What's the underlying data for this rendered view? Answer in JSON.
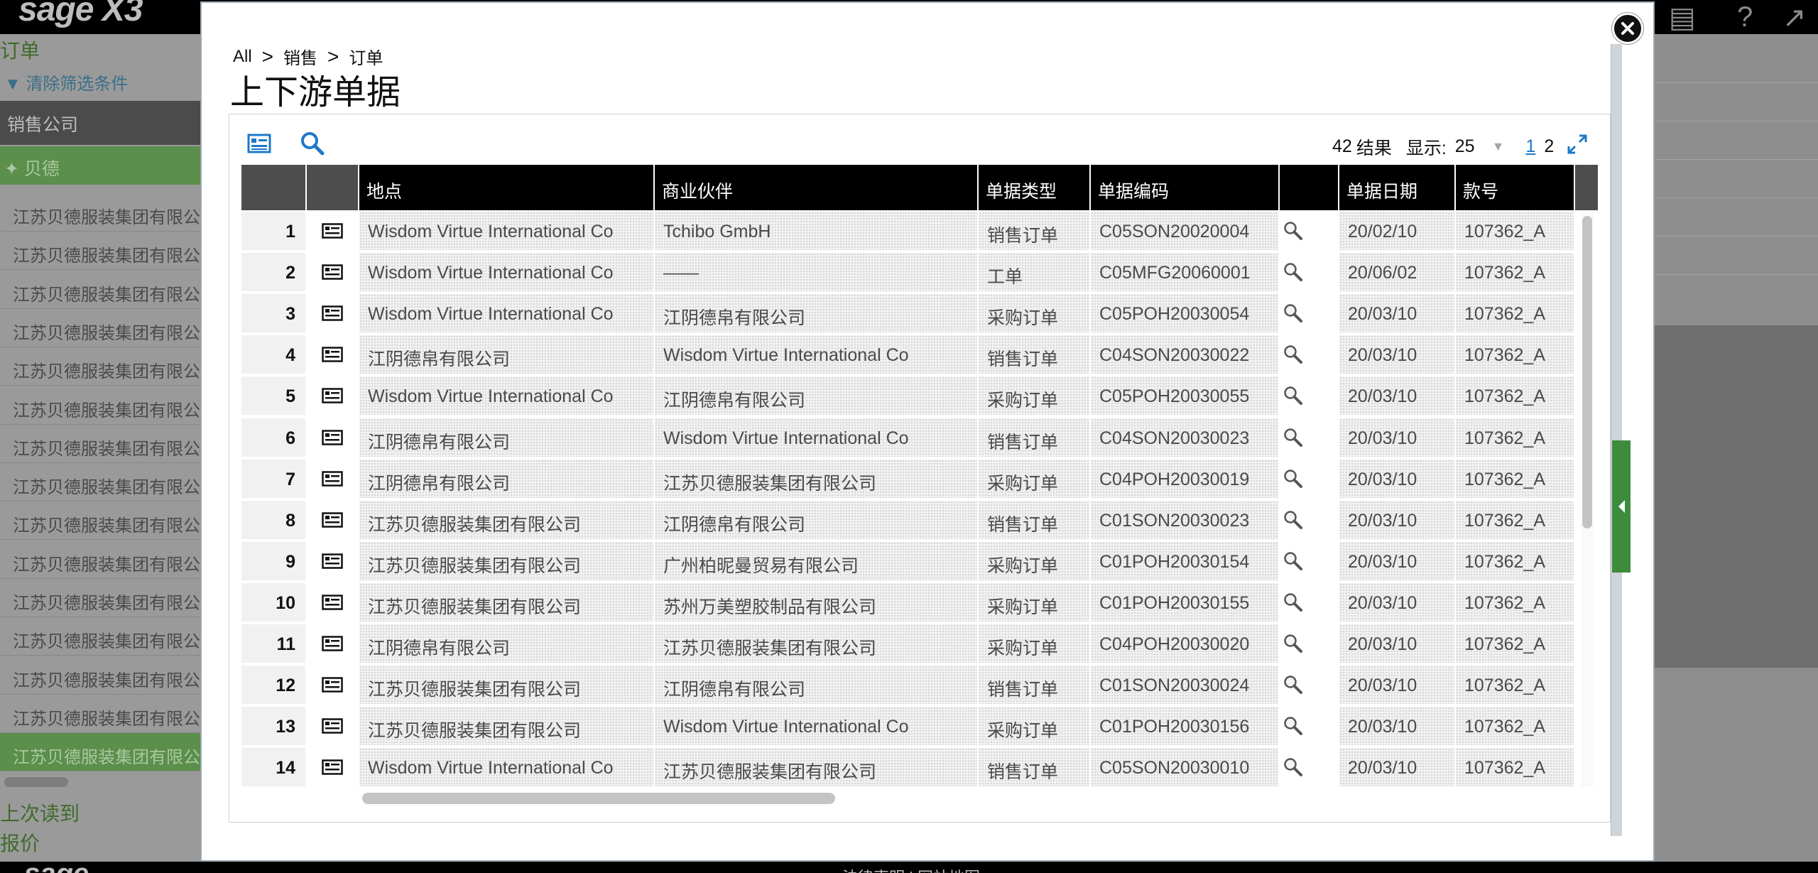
{
  "background": {
    "logo": "sage X3",
    "left_panel": {
      "title": "订单",
      "clear_filters": "清除筛选条件",
      "sales_company_header": "销售公司",
      "selected_company": "贝德",
      "company_rows": [
        "江苏贝德服装集团有限公",
        "江苏贝德服装集团有限公",
        "江苏贝德服装集团有限公",
        "江苏贝德服装集团有限公",
        "江苏贝德服装集团有限公",
        "江苏贝德服装集团有限公",
        "江苏贝德服装集团有限公",
        "江苏贝德服装集团有限公",
        "江苏贝德服装集团有限公",
        "江苏贝德服装集团有限公",
        "江苏贝德服装集团有限公",
        "江苏贝德服装集团有限公",
        "江苏贝德服装集团有限公",
        "江苏贝德服装集团有限公",
        "江苏贝德服装集团有限公"
      ],
      "last_read": "上次读到",
      "quote": "报价"
    },
    "footer_logo": "sage",
    "footer_links": "法律声明 | 网站地图"
  },
  "modal": {
    "breadcrumb": {
      "all": "All",
      "sep": ">",
      "sales": "销售",
      "orders": "订单"
    },
    "title": "上下游单据",
    "results": {
      "count": "42",
      "label": "结果",
      "show_label": "显示:",
      "page_size": "25",
      "page_1": "1",
      "page_2": "2"
    },
    "columns": {
      "site": "地点",
      "partner": "商业伙伴",
      "doc_type": "单据类型",
      "doc_no": "单据编码",
      "doc_date": "单据日期",
      "style_no": "款号"
    },
    "rows": [
      {
        "n": "1",
        "site": "Wisdom Virtue International Co",
        "partner": "Tchibo GmbH",
        "type": "销售订单",
        "no": "C05SON20020004",
        "date": "20/02/10",
        "style": "107362_A"
      },
      {
        "n": "2",
        "site": "Wisdom Virtue International Co",
        "partner": "——",
        "type": "工单",
        "no": "C05MFG20060001",
        "date": "20/06/02",
        "style": "107362_A"
      },
      {
        "n": "3",
        "site": "Wisdom Virtue International Co",
        "partner": "江阴德帛有限公司",
        "type": "采购订单",
        "no": "C05POH20030054",
        "date": "20/03/10",
        "style": "107362_A"
      },
      {
        "n": "4",
        "site": "江阴德帛有限公司",
        "partner": "Wisdom Virtue International Co",
        "type": "销售订单",
        "no": "C04SON20030022",
        "date": "20/03/10",
        "style": "107362_A"
      },
      {
        "n": "5",
        "site": "Wisdom Virtue International Co",
        "partner": "江阴德帛有限公司",
        "type": "采购订单",
        "no": "C05POH20030055",
        "date": "20/03/10",
        "style": "107362_A"
      },
      {
        "n": "6",
        "site": "江阴德帛有限公司",
        "partner": "Wisdom Virtue International Co",
        "type": "销售订单",
        "no": "C04SON20030023",
        "date": "20/03/10",
        "style": "107362_A"
      },
      {
        "n": "7",
        "site": "江阴德帛有限公司",
        "partner": "江苏贝德服装集团有限公司",
        "type": "采购订单",
        "no": "C04POH20030019",
        "date": "20/03/10",
        "style": "107362_A"
      },
      {
        "n": "8",
        "site": "江苏贝德服装集团有限公司",
        "partner": "江阴德帛有限公司",
        "type": "销售订单",
        "no": "C01SON20030023",
        "date": "20/03/10",
        "style": "107362_A"
      },
      {
        "n": "9",
        "site": "江苏贝德服装集团有限公司",
        "partner": "广州柏昵曼贸易有限公司",
        "type": "采购订单",
        "no": "C01POH20030154",
        "date": "20/03/10",
        "style": "107362_A"
      },
      {
        "n": "10",
        "site": "江苏贝德服装集团有限公司",
        "partner": "苏州万美塑胶制品有限公司",
        "type": "采购订单",
        "no": "C01POH20030155",
        "date": "20/03/10",
        "style": "107362_A"
      },
      {
        "n": "11",
        "site": "江阴德帛有限公司",
        "partner": "江苏贝德服装集团有限公司",
        "type": "采购订单",
        "no": "C04POH20030020",
        "date": "20/03/10",
        "style": "107362_A"
      },
      {
        "n": "12",
        "site": "江苏贝德服装集团有限公司",
        "partner": "江阴德帛有限公司",
        "type": "销售订单",
        "no": "C01SON20030024",
        "date": "20/03/10",
        "style": "107362_A"
      },
      {
        "n": "13",
        "site": "江苏贝德服装集团有限公司",
        "partner": "Wisdom Virtue International Co",
        "type": "采购订单",
        "no": "C01POH20030156",
        "date": "20/03/10",
        "style": "107362_A"
      },
      {
        "n": "14",
        "site": "Wisdom Virtue International Co",
        "partner": "江苏贝德服装集团有限公司",
        "type": "销售订单",
        "no": "C05SON20030010",
        "date": "20/03/10",
        "style": "107362_A"
      }
    ]
  },
  "colors": {
    "accent_blue": "#1d79c8",
    "header_black": "#000000",
    "green_tab": "#3c8c3c"
  }
}
